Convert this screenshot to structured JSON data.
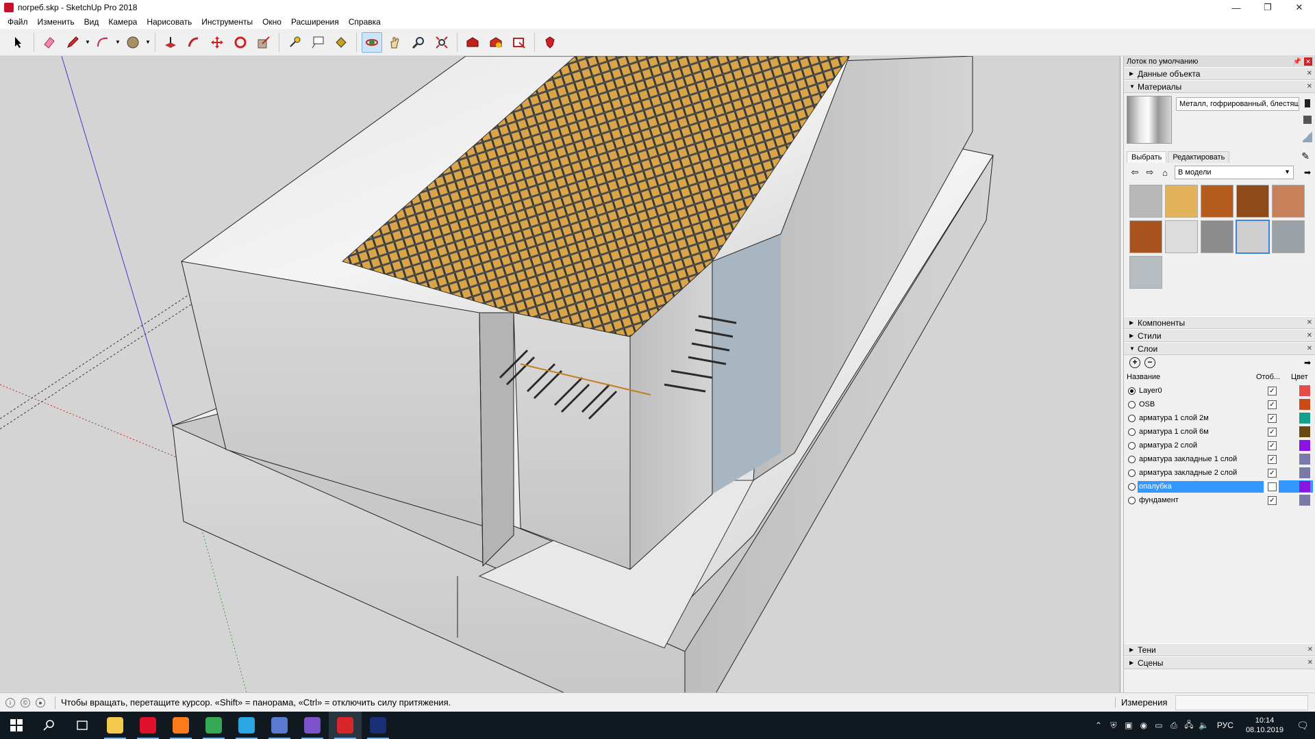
{
  "window": {
    "title": "погреб.skp - SketchUp Pro 2018",
    "minimize": "—",
    "restore": "❐",
    "close": "✕"
  },
  "menu": [
    "Файл",
    "Изменить",
    "Вид",
    "Камера",
    "Нарисовать",
    "Инструменты",
    "Окно",
    "Расширения",
    "Справка"
  ],
  "toolbar": {
    "tools": [
      {
        "name": "select-tool",
        "icon": "arrow-icon"
      },
      {
        "name": "eraser-tool",
        "icon": "eraser-icon"
      },
      {
        "name": "line-tool",
        "icon": "pencil-icon"
      },
      {
        "name": "arc-tool",
        "icon": "arc-icon"
      },
      {
        "name": "shape-tool",
        "icon": "circle-icon"
      },
      {
        "name": "push-pull-tool",
        "icon": "push-pull-icon"
      },
      {
        "name": "follow-me-tool",
        "icon": "follow-me-icon"
      },
      {
        "name": "move-tool",
        "icon": "move-icon"
      },
      {
        "name": "rotate-tool",
        "icon": "rotate-icon"
      },
      {
        "name": "scale-tool",
        "icon": "scale-icon"
      },
      {
        "name": "tape-measure-tool",
        "icon": "tape-icon"
      },
      {
        "name": "text-tool",
        "icon": "text-icon"
      },
      {
        "name": "paint-bucket-tool",
        "icon": "paint-bucket-icon"
      },
      {
        "name": "orbit-tool",
        "icon": "orbit-icon",
        "active": true
      },
      {
        "name": "pan-tool",
        "icon": "hand-icon"
      },
      {
        "name": "zoom-tool",
        "icon": "zoom-icon"
      },
      {
        "name": "zoom-extents-tool",
        "icon": "zoom-extents-icon"
      },
      {
        "name": "warehouse-tool",
        "icon": "warehouse-icon"
      },
      {
        "name": "extension-warehouse-tool",
        "icon": "extension-icon"
      },
      {
        "name": "layout-tool",
        "icon": "layout-icon"
      },
      {
        "name": "ruby-tool",
        "icon": "ruby-icon"
      }
    ]
  },
  "tray": {
    "title": "Лоток по умолчанию",
    "panels": {
      "entity_info": "Данные объекта",
      "materials": "Материалы",
      "components": "Компоненты",
      "styles": "Стили",
      "layers": "Слои",
      "shadows": "Тени",
      "scenes": "Сцены"
    },
    "materials": {
      "current_name": "Металл, гофрированный, блестящ",
      "tab_select": "Выбрать",
      "tab_edit": "Редактировать",
      "collection": "В модели",
      "swatches": [
        {
          "name": "concrete",
          "color": "#b8b8b8"
        },
        {
          "name": "osb",
          "color": "#e2b35a"
        },
        {
          "name": "wood-1",
          "color": "#b35c1e"
        },
        {
          "name": "wood-2",
          "color": "#8e4a18"
        },
        {
          "name": "wood-3",
          "color": "#c8805a"
        },
        {
          "name": "wood-4",
          "color": "#a8521e"
        },
        {
          "name": "marble",
          "color": "#dcdcdc"
        },
        {
          "name": "metal-plate",
          "color": "#8c8c8c"
        },
        {
          "name": "metal-corrugated",
          "color": "#cfcfcf",
          "selected": true
        },
        {
          "name": "gray-1",
          "color": "#9aa2a8"
        },
        {
          "name": "gray-2",
          "color": "#b6bcc0"
        }
      ]
    },
    "layers": {
      "col_name": "Название",
      "col_visible": "Отоб...",
      "col_color": "Цвет",
      "rows": [
        {
          "name": "Layer0",
          "current": true,
          "visible": true,
          "color": "#e44c4c"
        },
        {
          "name": "OSB",
          "current": false,
          "visible": true,
          "color": "#c84c14"
        },
        {
          "name": "арматура 1 слой 2м",
          "current": false,
          "visible": true,
          "color": "#14a08c"
        },
        {
          "name": "арматура 1 слой 6м",
          "current": false,
          "visible": true,
          "color": "#6a4a10"
        },
        {
          "name": "арматура 2 слой",
          "current": false,
          "visible": true,
          "color": "#8a14e0"
        },
        {
          "name": "арматура закладные 1 слой",
          "current": false,
          "visible": true,
          "color": "#7a7aa8"
        },
        {
          "name": "арматура закладные 2 слой",
          "current": false,
          "visible": true,
          "color": "#7a7aa8"
        },
        {
          "name": "опалубка",
          "current": false,
          "visible": false,
          "selected": true,
          "color": "#8a14e0"
        },
        {
          "name": "фундамент",
          "current": false,
          "visible": true,
          "color": "#7a7aa8"
        }
      ]
    }
  },
  "status": {
    "hint": "Чтобы вращать, перетащите курсор. «Shift» = панорама, «Ctrl» = отключить силу притяжения.",
    "measure_label": "Измерения",
    "measure_value": ""
  },
  "taskbar": {
    "apps": [
      {
        "name": "start-button",
        "color": "#ffffff"
      },
      {
        "name": "search-button",
        "color": "#ffffff"
      },
      {
        "name": "task-view-button",
        "color": "#ffffff"
      },
      {
        "name": "file-explorer",
        "color": "#f2c94c"
      },
      {
        "name": "opera",
        "color": "#e0102c"
      },
      {
        "name": "firefox",
        "color": "#ff7a1a"
      },
      {
        "name": "chrome",
        "color": "#34a853"
      },
      {
        "name": "app-gallery",
        "color": "#2aa6e0"
      },
      {
        "name": "app-monitor",
        "color": "#5a7ad0"
      },
      {
        "name": "viber",
        "color": "#7b52c8"
      },
      {
        "name": "sketchup",
        "color": "#d8262a"
      },
      {
        "name": "photoshop",
        "color": "#1b2e78"
      }
    ],
    "lang": "РУС",
    "time": "10:14",
    "date": "08.10.2019"
  }
}
